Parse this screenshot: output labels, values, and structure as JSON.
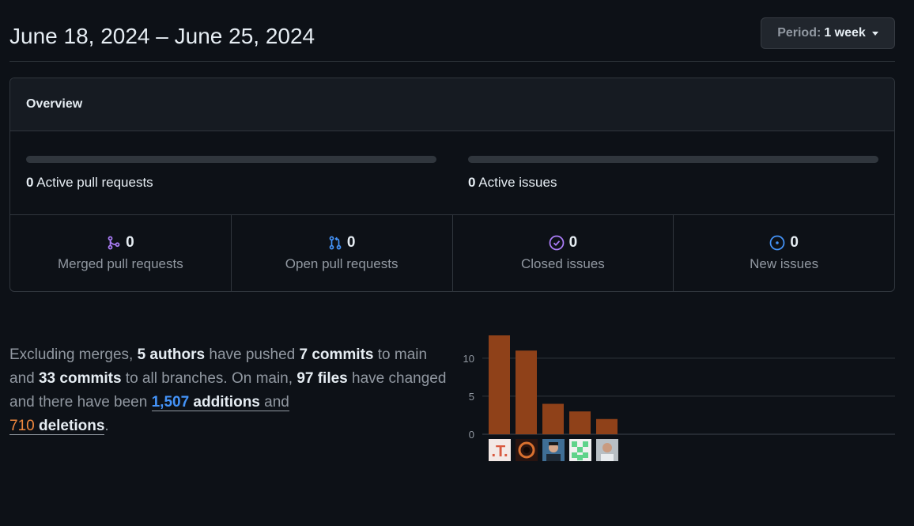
{
  "header": {
    "date_range": "June 18, 2024 – June 25, 2024",
    "period_label": "Period:",
    "period_value": "1 week"
  },
  "overview": {
    "title": "Overview",
    "active_prs": {
      "count": "0",
      "label": "Active pull requests"
    },
    "active_issues": {
      "count": "0",
      "label": "Active issues"
    },
    "stats": [
      {
        "count": "0",
        "label": "Merged pull requests",
        "icon": "git-merge-icon",
        "color": "#ab7df8"
      },
      {
        "count": "0",
        "label": "Open pull requests",
        "icon": "git-pull-request-icon",
        "color": "#4493f8"
      },
      {
        "count": "0",
        "label": "Closed issues",
        "icon": "issue-closed-icon",
        "color": "#ab7df8"
      },
      {
        "count": "0",
        "label": "New issues",
        "icon": "issue-opened-icon",
        "color": "#4493f8"
      }
    ]
  },
  "summary": {
    "t1": "Excluding merges, ",
    "authors": "5 authors",
    "t2": " have pushed ",
    "commits_main": "7 commits",
    "t3": " to main and ",
    "commits_all": "33 commits",
    "t4": " to all branches. On main, ",
    "files": "97 files",
    "t5": " have changed and there have been ",
    "additions_num": "1,507",
    "additions_word": "additions",
    "t6": " and",
    "deletions_num": "710",
    "deletions_word": "deletions",
    "t7": "."
  },
  "chart_data": {
    "type": "bar",
    "categories": [
      "author-1",
      "author-2",
      "author-3",
      "author-4",
      "author-5"
    ],
    "values": [
      13,
      11,
      4,
      3,
      2
    ],
    "ylim": [
      0,
      13
    ],
    "yticks": [
      0,
      5,
      10
    ],
    "bar_color": "#8f4119",
    "grid": true
  }
}
